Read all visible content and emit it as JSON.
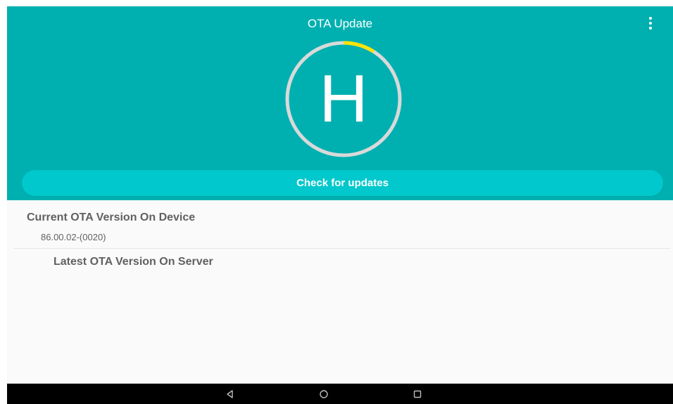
{
  "app": {
    "title": "OTA Update",
    "logo_letter": "H"
  },
  "colors": {
    "header": "#00b0b0",
    "button": "#00c8cc",
    "ring": "#d9d9d9",
    "progress": "#ffe400",
    "text_gray": "#616161"
  },
  "progress": {
    "fraction": 0.09
  },
  "actions": {
    "check_label": "Check for updates"
  },
  "current": {
    "title": "Current OTA Version On Device",
    "value": "86.00.02-(0020)"
  },
  "latest": {
    "title": "Latest OTA Version On Server"
  },
  "icons": {
    "menu": "more-vert-icon",
    "back": "back-triangle-icon",
    "home": "home-circle-icon",
    "recent": "recent-square-icon"
  }
}
